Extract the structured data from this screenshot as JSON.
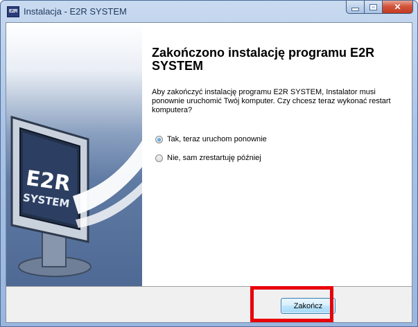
{
  "window": {
    "title": "Instalacja - E2R SYSTEM",
    "icon_text": "E2R",
    "caption_buttons": [
      "minimize-icon",
      "maximize-icon",
      "close-icon"
    ]
  },
  "banner": {
    "logo_line1": "E2R",
    "logo_line2": "SYSTEM"
  },
  "content": {
    "heading": "Zakończono instalację programu E2R SYSTEM",
    "message": "Aby zakończyć instalację programu E2R SYSTEM, Instalator musi ponownie uruchomić Twój komputer. Czy chcesz teraz wykonać restart komputera?",
    "options": [
      {
        "label": "Tak, teraz uruchom ponownie",
        "selected": true
      },
      {
        "label": "Nie, sam zrestartuję później",
        "selected": false
      }
    ]
  },
  "buttons": {
    "finish_label": "Zakończ"
  },
  "colors": {
    "highlight": "#e8000a",
    "button_border": "#3c7fb1"
  }
}
